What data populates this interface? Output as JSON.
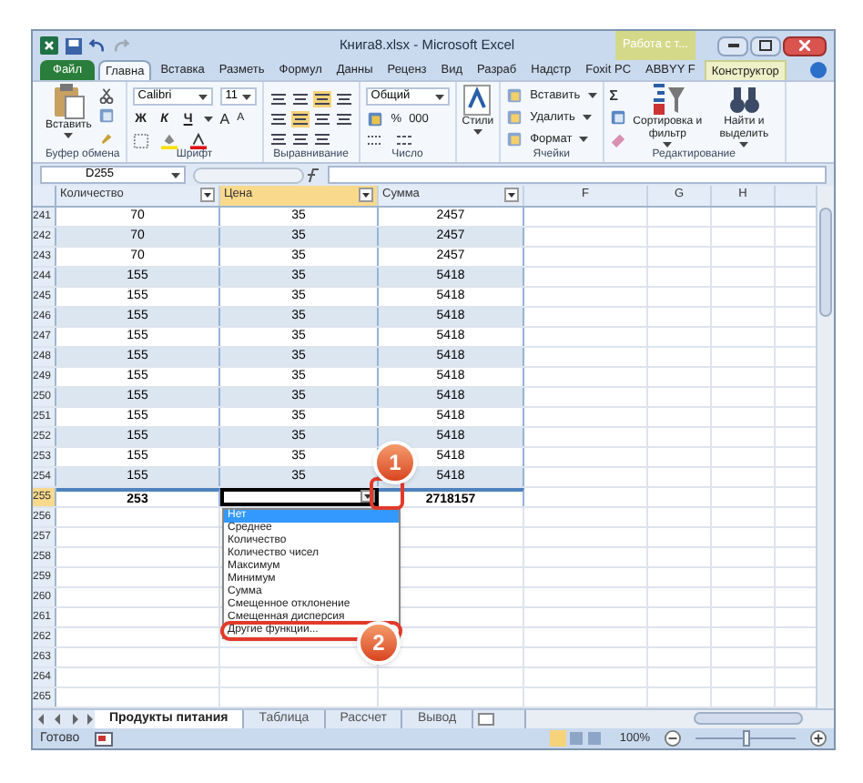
{
  "window": {
    "title": "Книга8.xlsx - Microsoft Excel",
    "context_tab": "Работа с т..."
  },
  "ribbon_tabs": [
    {
      "label": "Файл",
      "kind": "file",
      "selected": false
    },
    {
      "label": "Главна",
      "kind": "tab",
      "selected": true
    },
    {
      "label": "Вставка",
      "kind": "tab",
      "selected": false
    },
    {
      "label": "Разметь",
      "kind": "tab",
      "selected": false
    },
    {
      "label": "Формул",
      "kind": "tab",
      "selected": false
    },
    {
      "label": "Данны",
      "kind": "tab",
      "selected": false
    },
    {
      "label": "Реценз",
      "kind": "tab",
      "selected": false
    },
    {
      "label": "Вид",
      "kind": "tab",
      "selected": false
    },
    {
      "label": "Разраб",
      "kind": "tab",
      "selected": false
    },
    {
      "label": "Надстр",
      "kind": "tab",
      "selected": false
    },
    {
      "label": "Foxit PC",
      "kind": "tab",
      "selected": false
    },
    {
      "label": "ABBYY F",
      "kind": "tab",
      "selected": false
    },
    {
      "label": "Конструктор",
      "kind": "context",
      "selected": false
    }
  ],
  "ribbon_groups": [
    {
      "label": "Буфер обмена",
      "items": [
        {
          "kind": "paste",
          "label": "Вставить"
        },
        {
          "kind": "tools"
        }
      ]
    },
    {
      "label": "Шрифт",
      "items": [
        {
          "kind": "font",
          "font": "Calibri",
          "size": "11",
          "buttons": [
            "Ж",
            "К",
            "Ч"
          ],
          "grow": "A",
          "shrink": "A"
        }
      ]
    },
    {
      "label": "Выравнивание",
      "items": [
        {
          "kind": "align"
        }
      ]
    },
    {
      "label": "Число",
      "items": [
        {
          "kind": "number",
          "format": "Общий",
          "buttons": [
            "%",
            "000"
          ]
        }
      ]
    },
    {
      "items": [
        {
          "kind": "styles",
          "label": "Стили"
        }
      ]
    },
    {
      "label": "Ячейки",
      "items": [
        {
          "kind": "list",
          "buttons": [
            "Вставить",
            "Удалить",
            "Формат"
          ]
        }
      ]
    },
    {
      "label": "Редактирование",
      "items": [
        {
          "kind": "sigma",
          "symbol": "Σ"
        },
        {
          "kind": "sort",
          "label": "Сортировка и фильтр"
        },
        {
          "kind": "find",
          "label": "Найти и выделить"
        }
      ]
    }
  ],
  "name_box": "D255",
  "columns": [
    {
      "label": "Количество",
      "filter": true,
      "selected": false
    },
    {
      "label": "Цена",
      "filter": true,
      "selected": true
    },
    {
      "label": "Сумма",
      "filter": true,
      "selected": false
    },
    {
      "label": "F",
      "filter": false,
      "selected": false
    },
    {
      "label": "G",
      "filter": false,
      "selected": false
    },
    {
      "label": "H",
      "filter": false,
      "selected": false
    }
  ],
  "rows": [
    {
      "number": "241",
      "cells": [
        "70",
        "35",
        "2457"
      ]
    },
    {
      "number": "242",
      "cells": [
        "70",
        "35",
        "2457"
      ]
    },
    {
      "number": "243",
      "cells": [
        "70",
        "35",
        "2457"
      ]
    },
    {
      "number": "244",
      "cells": [
        "155",
        "35",
        "5418"
      ]
    },
    {
      "number": "245",
      "cells": [
        "155",
        "35",
        "5418"
      ]
    },
    {
      "number": "246",
      "cells": [
        "155",
        "35",
        "5418"
      ]
    },
    {
      "number": "247",
      "cells": [
        "155",
        "35",
        "5418"
      ]
    },
    {
      "number": "248",
      "cells": [
        "155",
        "35",
        "5418"
      ]
    },
    {
      "number": "249",
      "cells": [
        "155",
        "35",
        "5418"
      ]
    },
    {
      "number": "250",
      "cells": [
        "155",
        "35",
        "5418"
      ]
    },
    {
      "number": "251",
      "cells": [
        "155",
        "35",
        "5418"
      ]
    },
    {
      "number": "252",
      "cells": [
        "155",
        "35",
        "5418"
      ]
    },
    {
      "number": "253",
      "cells": [
        "155",
        "35",
        "5418"
      ]
    },
    {
      "number": "254",
      "cells": [
        "155",
        "35",
        "5418"
      ]
    }
  ],
  "total_row": {
    "number": "255",
    "quantity": "253",
    "sum": "2718157",
    "selected": true
  },
  "empty_rows": [
    "256",
    "257",
    "258",
    "259",
    "260",
    "261",
    "262",
    "263",
    "264",
    "265"
  ],
  "dropdown": {
    "items": [
      {
        "label": "Нет",
        "selected": true,
        "outlined": false
      },
      {
        "label": "Среднее",
        "selected": false,
        "outlined": false
      },
      {
        "label": "Количество",
        "selected": false,
        "outlined": false
      },
      {
        "label": "Количество чисел",
        "selected": false,
        "outlined": false
      },
      {
        "label": "Максимум",
        "selected": false,
        "outlined": false
      },
      {
        "label": "Минимум",
        "selected": false,
        "outlined": false
      },
      {
        "label": "Сумма",
        "selected": false,
        "outlined": false
      },
      {
        "label": "Смещенное отклонение",
        "selected": false,
        "outlined": false
      },
      {
        "label": "Смещенная дисперсия",
        "selected": false,
        "outlined": false
      },
      {
        "label": "Другие функции...",
        "selected": false,
        "outlined": true
      }
    ]
  },
  "callouts": [
    "1",
    "2"
  ],
  "sheet_tabs": [
    {
      "label": "Продукты питания",
      "selected": true
    },
    {
      "label": "Таблица",
      "selected": false
    },
    {
      "label": "Рассчет",
      "selected": false
    },
    {
      "label": "Вывод",
      "selected": false
    }
  ],
  "status_bar": {
    "text": "Готово",
    "zoom": "100%",
    "zoom_slider": {
      "level": 0.5
    }
  }
}
